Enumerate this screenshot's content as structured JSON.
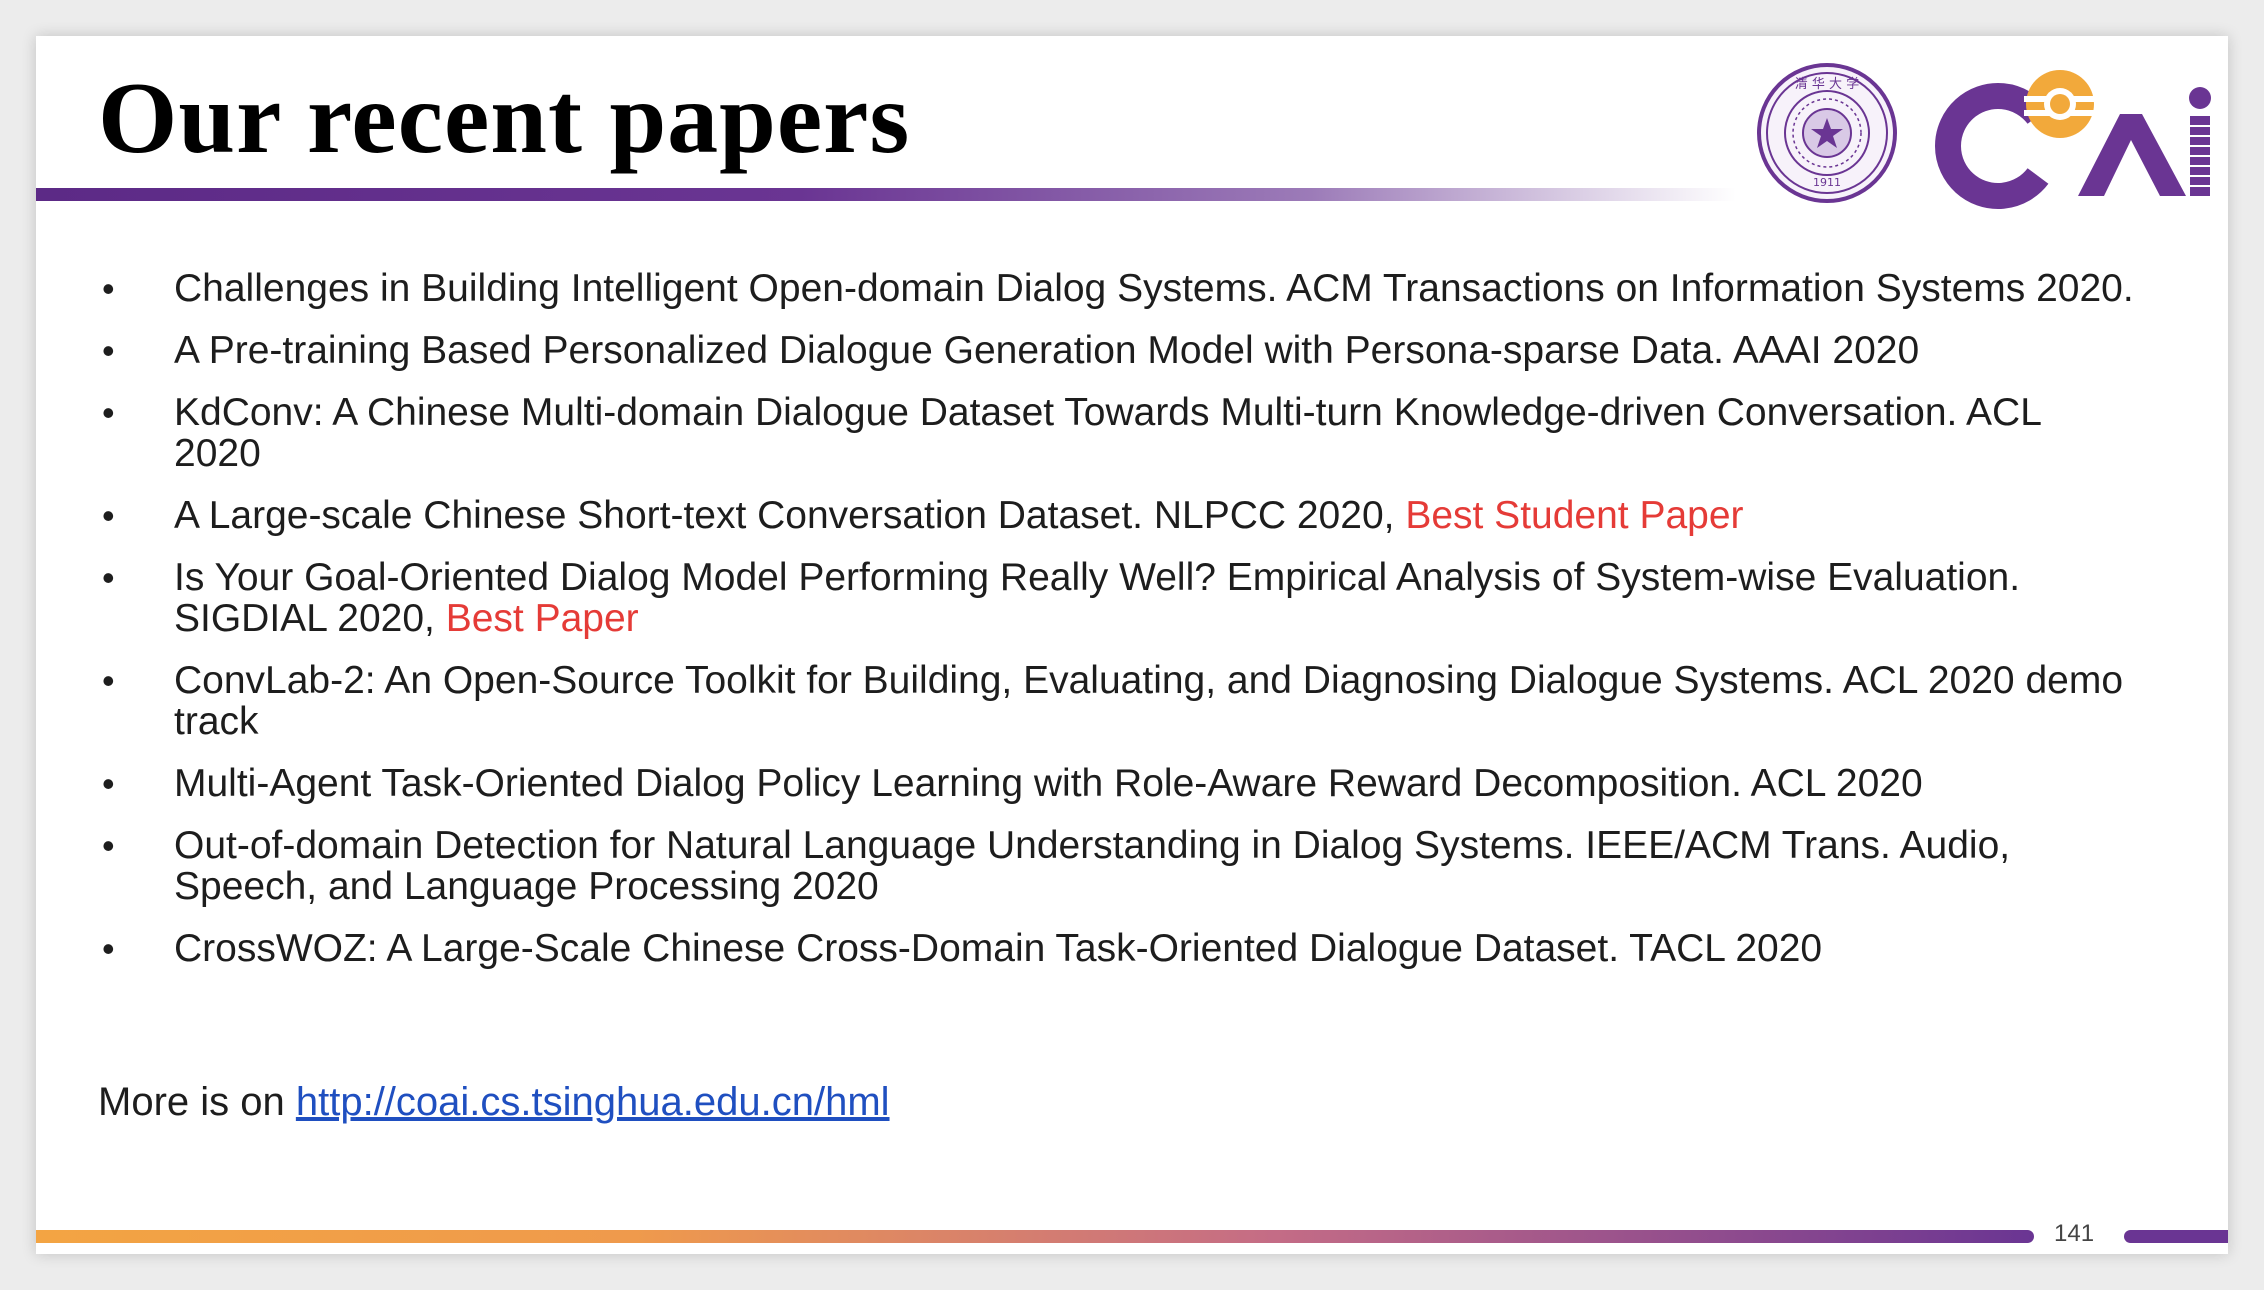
{
  "slide": {
    "title": "Our recent papers",
    "page_number": "141",
    "logos": {
      "seal_text": "TSINGHUA UNIVERSITY · 1911",
      "coai_text": "CoAI",
      "colors": {
        "purple": "#6a3593",
        "gold": "#f2a93b"
      }
    }
  },
  "papers": [
    {
      "text": "Challenges in Building Intelligent Open-domain Dialog Systems. ACM Transactions on Information Systems 2020.",
      "award": ""
    },
    {
      "text": "A Pre-training Based Personalized Dialogue Generation Model with Persona-sparse Data. AAAI 2020",
      "award": ""
    },
    {
      "text": "KdConv: A Chinese Multi-domain Dialogue Dataset Towards Multi-turn Knowledge-driven Conversation. ACL 2020",
      "award": ""
    },
    {
      "text": "A Large-scale Chinese Short-text Conversation Dataset. NLPCC 2020, ",
      "award": "Best Student Paper"
    },
    {
      "text": "Is Your Goal-Oriented Dialog Model Performing Really Well? Empirical Analysis of System-wise Evaluation. SIGDIAL 2020, ",
      "award": "Best Paper"
    },
    {
      "text": "ConvLab-2: An Open-Source Toolkit for Building, Evaluating, and Diagnosing Dialogue Systems. ACL 2020 demo track",
      "award": ""
    },
    {
      "text": "Multi-Agent Task-Oriented Dialog Policy Learning with Role-Aware Reward Decomposition. ACL 2020",
      "award": ""
    },
    {
      "text": "Out-of-domain Detection for Natural Language Understanding in Dialog Systems. IEEE/ACM Trans. Audio, Speech, and Language Processing 2020",
      "award": ""
    },
    {
      "text": "CrossWOZ: A Large-Scale Chinese Cross-Domain Task-Oriented Dialogue Dataset. TACL 2020",
      "award": ""
    }
  ],
  "more": {
    "prefix": "More  is on ",
    "link_text": "http://coai.cs.tsinghua.edu.cn/hml"
  },
  "colors": {
    "award": "#e53b37",
    "link": "#1f4fc0",
    "title_rule": "#5c2a86",
    "bottom_rule_start": "#f3a443",
    "bottom_rule_end": "#6a3593"
  }
}
